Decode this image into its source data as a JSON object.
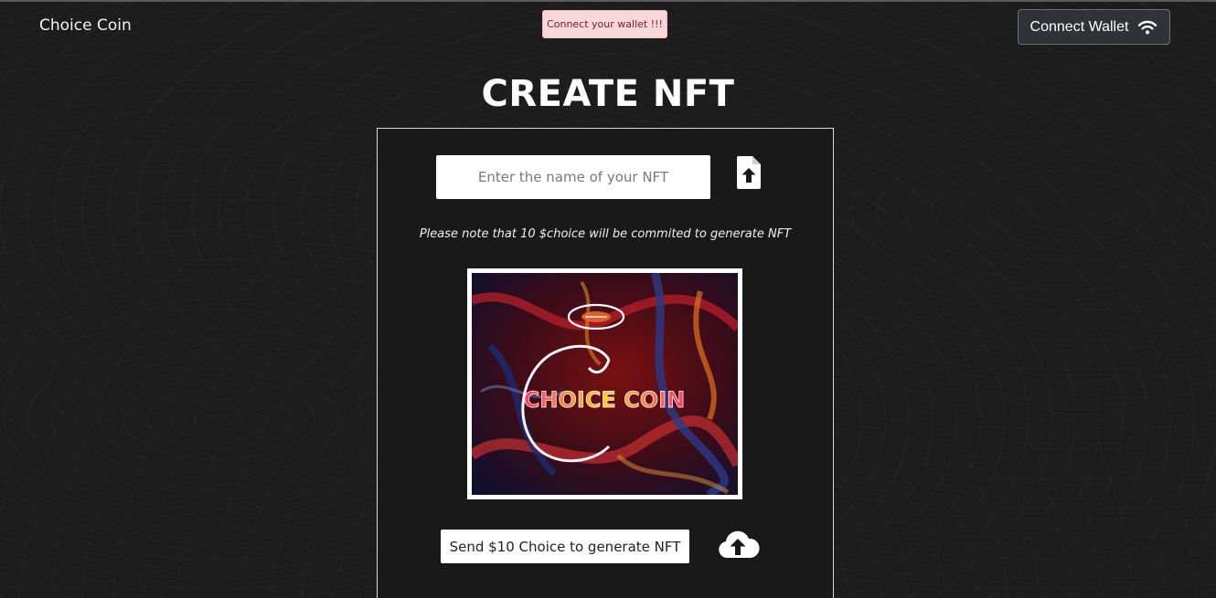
{
  "header": {
    "brand": "Choice Coin",
    "toast_message": "Connect your wallet !!!",
    "connect_wallet_label": "Connect Wallet",
    "connect_wallet_icon": "wifi-icon"
  },
  "main": {
    "title": "CREATE NFT",
    "name_input": {
      "placeholder": "Enter the name of your NFT",
      "value": ""
    },
    "file_upload_icon": "file-upload-icon",
    "note": "Please note that 10 $choice will be commited to generate NFT",
    "nft_image": {
      "caption_text": "CHOICE COIN"
    },
    "send_button_label": "Send $10 Choice to generate NFT",
    "cloud_upload_icon": "cloud-upload-icon"
  },
  "colors": {
    "background": "#1c1c1c",
    "toast_background": "#f8d7da",
    "toast_text": "#721c24",
    "connect_button_background": "#2f3338"
  }
}
